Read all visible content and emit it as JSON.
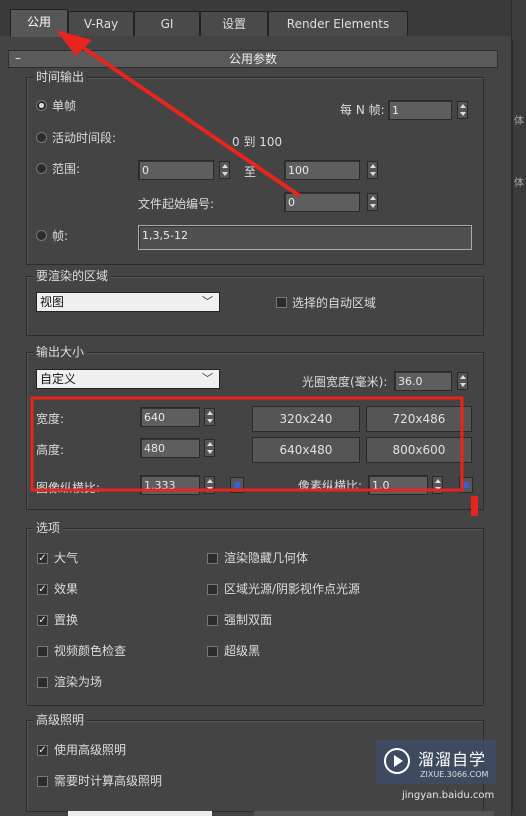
{
  "tabs": [
    "公用",
    "V-Ray",
    "GI",
    "设置",
    "Render Elements"
  ],
  "rollout": {
    "collapse_symbol": "–",
    "title": "公用参数"
  },
  "time_output": {
    "title": "时间输出",
    "single": "单帧",
    "every_n_label": "每 N 帧:",
    "every_n_value": "1",
    "active_segment": "活动时间段:",
    "active_range": "0 到 100",
    "range": "范围:",
    "range_from": "0",
    "range_to_label": "至",
    "range_to": "100",
    "file_start_label": "文件起始编号:",
    "file_start_value": "0",
    "frames": "帧:",
    "frames_value": "1,3,5-12"
  },
  "area": {
    "title": "要渲染的区域",
    "view_value": "视图",
    "auto_region": "选择的自动区域"
  },
  "output_size": {
    "title": "输出大小",
    "preset_value": "自定义",
    "aperture_label": "光圈宽度(毫米):",
    "aperture_value": "36.0",
    "width_label": "宽度:",
    "width_value": "640",
    "height_label": "高度:",
    "height_value": "480",
    "image_aspect_label": "图像纵横比:",
    "image_aspect_value": "1.333",
    "pixel_aspect_label": "像素纵横比:",
    "pixel_aspect_value": "1.0",
    "presets": [
      "320x240",
      "720x486",
      "640x480",
      "800x600"
    ]
  },
  "options": {
    "title": "选项",
    "items": [
      {
        "label": "大气",
        "checked": true
      },
      {
        "label": "渲染隐藏几何体",
        "checked": false
      },
      {
        "label": "效果",
        "checked": true
      },
      {
        "label": "区域光源/阴影视作点光源",
        "checked": false
      },
      {
        "label": "置换",
        "checked": true
      },
      {
        "label": "强制双面",
        "checked": false
      },
      {
        "label": "视频颜色检查",
        "checked": false
      },
      {
        "label": "超级黑",
        "checked": false
      },
      {
        "label": "渲染为场",
        "checked": false
      }
    ]
  },
  "advanced_lighting": {
    "title": "高级照明",
    "use": "使用高级照明",
    "use_checked": true,
    "compute": "需要时计算高级照明",
    "compute_checked": false
  },
  "right_strip_chars": [
    "体",
    "体"
  ],
  "watermark": {
    "main": "溜溜自学",
    "sub": "ZIXUE.3066.COM",
    "url": "jingyan.baidu.com"
  },
  "annotation_color": "#e8241f"
}
